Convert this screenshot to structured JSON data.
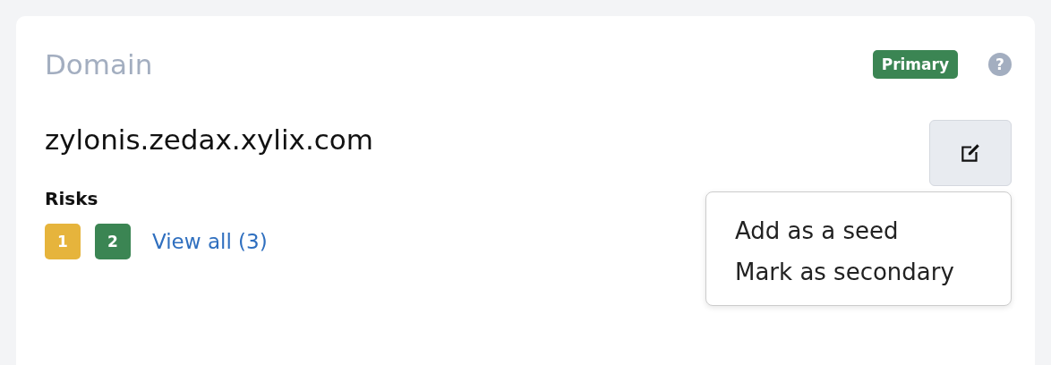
{
  "card": {
    "title": "Domain",
    "badge": "Primary",
    "help_icon": "?"
  },
  "domain": "zylonis.zedax.xylix.com",
  "menu": {
    "items": [
      {
        "label": "Add as a seed"
      },
      {
        "label": "Mark as secondary"
      }
    ]
  },
  "risks": {
    "label": "Risks",
    "counts": [
      {
        "label": "1",
        "color": "#e6b43c"
      },
      {
        "label": "2",
        "color": "#3b8553"
      }
    ],
    "link": "View all (3)"
  }
}
